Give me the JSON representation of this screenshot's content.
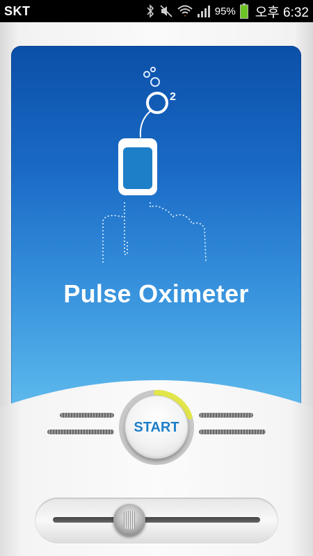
{
  "status_bar": {
    "carrier": "SKT",
    "battery_percent": "95%",
    "time": "오후 6:32",
    "icons": [
      "bluetooth-icon",
      "mute-icon",
      "wifi-icon",
      "signal-icon",
      "battery-icon"
    ]
  },
  "hero": {
    "title": "Pulse Oximeter",
    "superscript": "2",
    "icons": [
      "oxygen-bubbles-icon",
      "oxygen-o2-icon",
      "pulse-sensor-icon",
      "finger-outline-icon"
    ]
  },
  "controls": {
    "start_label": "START",
    "start_progress": 0.2,
    "slider_value": 0.37
  },
  "colors": {
    "panel_top": "#0b4fa8",
    "panel_bottom": "#5db9ec",
    "accent": "#1d7fc8",
    "progress_arc": "#e3e64a"
  }
}
